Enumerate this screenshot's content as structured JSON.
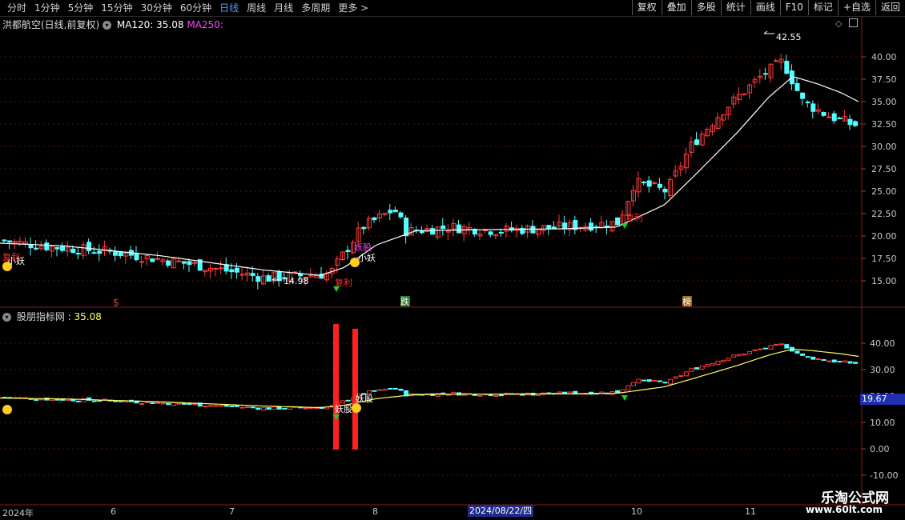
{
  "toolbar": {
    "periods": [
      "分时",
      "1分钟",
      "5分钟",
      "15分钟",
      "30分钟",
      "60分钟",
      "日线",
      "周线",
      "月线",
      "多周期",
      "更多"
    ],
    "active_period": "日线",
    "more_arrow": ">",
    "right_buttons": [
      "复权",
      "叠加",
      "多股",
      "统计",
      "画线",
      "F10",
      "标记",
      "+自选",
      "返回"
    ]
  },
  "main_pane": {
    "title": "洪都航空(日线,前复权)",
    "ma120_label": "MA120: 35.08",
    "ma250_label": "MA250:",
    "high_marker": "42.55",
    "low_marker": "14.98",
    "events": [
      {
        "text": "$",
        "color": "#ff3030"
      },
      {
        "text": "跌",
        "color": "#ffffff",
        "bg": "#2c7a2c"
      },
      {
        "text": "榜",
        "color": "#ffffff",
        "bg": "#a06a10"
      }
    ],
    "signals": {
      "fuli1": "复利",
      "xiaoyao1": "小妖",
      "yaogu1": "妖股",
      "xiaoyao2": "小妖",
      "fuli2": "复利",
      "fuli3": "复利"
    },
    "y_axis": [
      "40.00",
      "37.50",
      "35.00",
      "32.50",
      "30.00",
      "27.50",
      "25.00",
      "22.50",
      "20.00",
      "17.50",
      "15.00"
    ],
    "colors": {
      "up": "#ff3b3b",
      "down": "#54ffff",
      "ma": "#ffffff",
      "ma250": "#ff40ff"
    }
  },
  "sub_pane": {
    "title": "股朋指标网",
    "value": ": 35.08",
    "current_value_box": "19.67",
    "labels": {
      "yaogu_a": "妖股",
      "yaogu_b": "妖股"
    },
    "y_axis": [
      "40.00",
      "30.00",
      "20.00",
      "10.00",
      "0.00",
      "-10.00"
    ],
    "colors": {
      "line": "#ffff66",
      "bar": "#ff2020"
    }
  },
  "date_axis": {
    "labels": [
      "2024年",
      "6",
      "7",
      "8",
      "10",
      "11"
    ],
    "highlight": "2024/08/22/四"
  },
  "watermark": {
    "line1": "乐淘公式网",
    "line2": "www.60lt.com"
  },
  "chart_data": {
    "type": "candlestick",
    "title": "洪都航空(日线,前复权)",
    "y_range": [
      13.0,
      43.0
    ],
    "series": [
      {
        "name": "MA120",
        "note": "current 35.08"
      },
      {
        "name": "MA250",
        "note": "no value shown"
      }
    ],
    "annotations": {
      "period_high": 42.55,
      "period_low": 14.98
    },
    "approx_close_by_month": {
      "2024年": 18.5,
      "6": 17.5,
      "7": 15.5,
      "8": 21.0,
      "9": 21.0,
      "10": 26.0,
      "11": 37.0,
      "latest": 32.5
    }
  }
}
